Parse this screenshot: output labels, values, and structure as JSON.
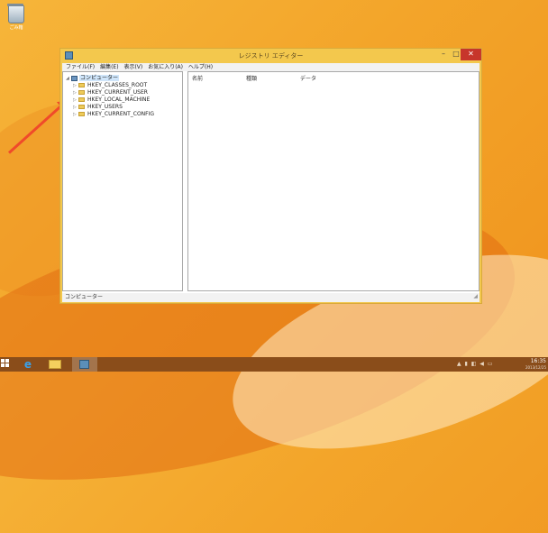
{
  "desktop": {
    "icon_label": "ごみ箱"
  },
  "window": {
    "title": "レジストリ エディター",
    "controls": {
      "minimize": "–",
      "maximize": "□",
      "close": "✕"
    },
    "menu": [
      "ファイル(F)",
      "編集(E)",
      "表示(V)",
      "お気に入り(A)",
      "ヘルプ(H)"
    ],
    "tree": {
      "root": "コンピューター",
      "children": [
        "HKEY_CLASSES_ROOT",
        "HKEY_CURRENT_USER",
        "HKEY_LOCAL_MACHINE",
        "HKEY_USERS",
        "HKEY_CURRENT_CONFIG"
      ]
    },
    "columns": [
      "名前",
      "種類",
      "データ"
    ],
    "status": "コンピューター"
  },
  "taskbar": {
    "time": "16:35",
    "date": "2013/12/25"
  },
  "icons": {
    "arrow_color": "#f04a2a",
    "accent": "#f3c84d"
  }
}
